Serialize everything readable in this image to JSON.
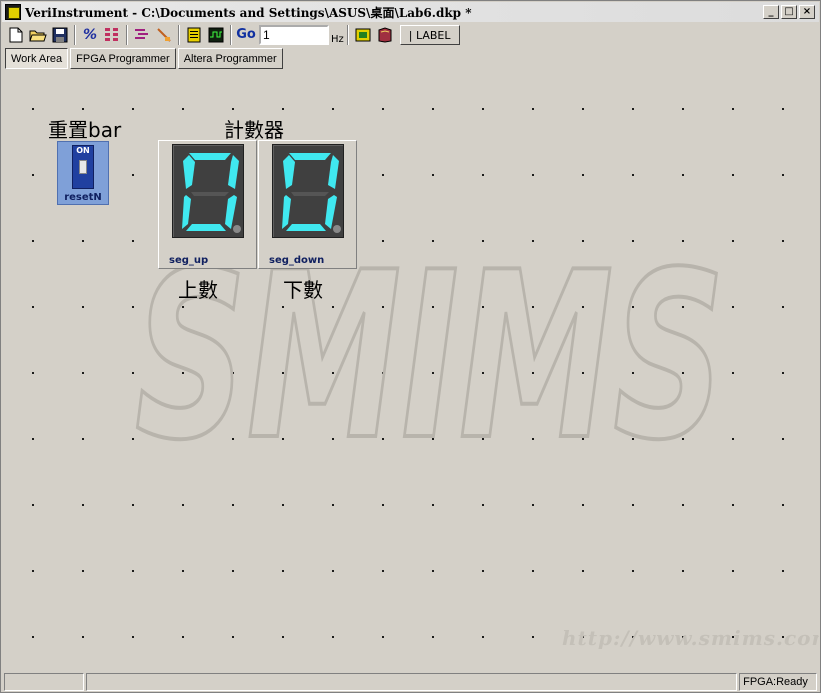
{
  "window": {
    "title": "VeriInstrument - C:\\Documents and Settings\\ASUS\\桌面\\Lab6.dkp *",
    "minimize": "_",
    "maximize": "□",
    "close": "×"
  },
  "toolbar": {
    "frequency_value": "1",
    "frequency_unit": "Hz",
    "go_label": "Go",
    "label_button": "| LABEL",
    "icons": [
      "new-file-icon",
      "open-folder-icon",
      "save-icon",
      "percent-icon",
      "grid-icon",
      "list-icon",
      "wire-icon",
      "memory-icon",
      "waveform-icon",
      "go-icon",
      "chip-icon",
      "book-icon"
    ]
  },
  "tabs": [
    {
      "label": "Work Area",
      "active": true
    },
    {
      "label": "FPGA Programmer",
      "active": false
    },
    {
      "label": "Altera Programmer",
      "active": false
    }
  ],
  "workarea": {
    "watermark": "SMIMS",
    "watermark_url": "http://www.smims.com",
    "labels": {
      "reset": "重置bar",
      "counter": "計數器",
      "up": "上數",
      "down": "下數"
    },
    "switch": {
      "state": "ON",
      "name": "resetN"
    },
    "seven_segments": [
      {
        "name": "seg_up",
        "digit": "0",
        "color": "#40e8f0"
      },
      {
        "name": "seg_down",
        "digit": "0",
        "color": "#40e8f0"
      }
    ]
  },
  "statusbar": {
    "cells": [
      "",
      "",
      "FPGA:Ready"
    ]
  },
  "colors": {
    "window_bg": "#d4d0c8",
    "segment_on": "#40e8f0",
    "switch_bg": "#7fa0d8"
  }
}
